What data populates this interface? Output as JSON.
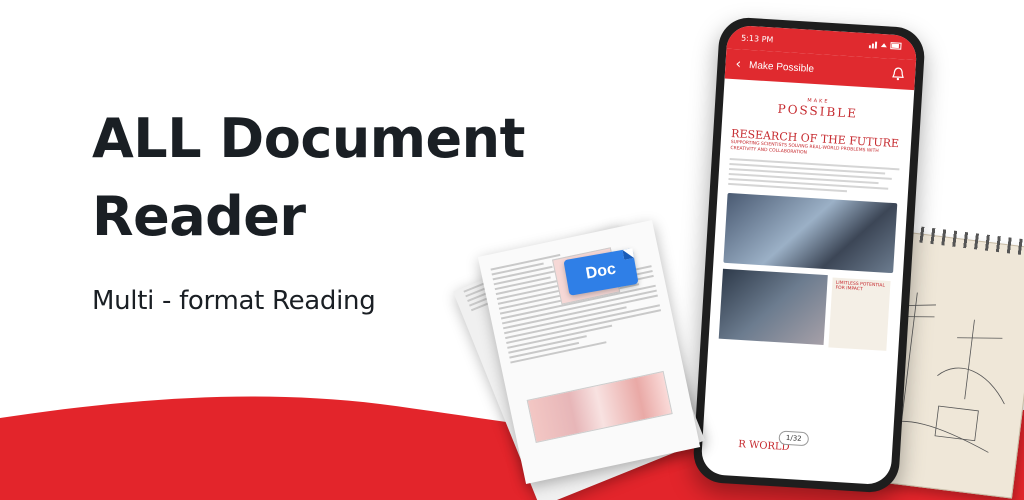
{
  "hero": {
    "headline": "ALL Document Reader",
    "subheadline": "Multi - format Reading"
  },
  "phone": {
    "status_time": "5:13 PM",
    "app_bar_title": "Make Possible",
    "document": {
      "logo_make": "MAKE",
      "logo_possible": "POSSIBLE",
      "heading": "RESEARCH OF THE FUTURE",
      "subheading": "SUPPORTING SCIENTISTS SOLVING REAL-WORLD PROBLEMS WITH CREATIVITY AND COLLABORATION",
      "sidebar_heading": "LIMITLESS POTENTIAL FOR IMPACT",
      "footer_heading": "R WORLD"
    },
    "page_indicator": "1/32"
  },
  "badge": {
    "label": "Doc"
  },
  "colors": {
    "brand_red": "#e02a2f",
    "doc_blue": "#2f7fe7",
    "text_dark": "#1a1f24"
  }
}
